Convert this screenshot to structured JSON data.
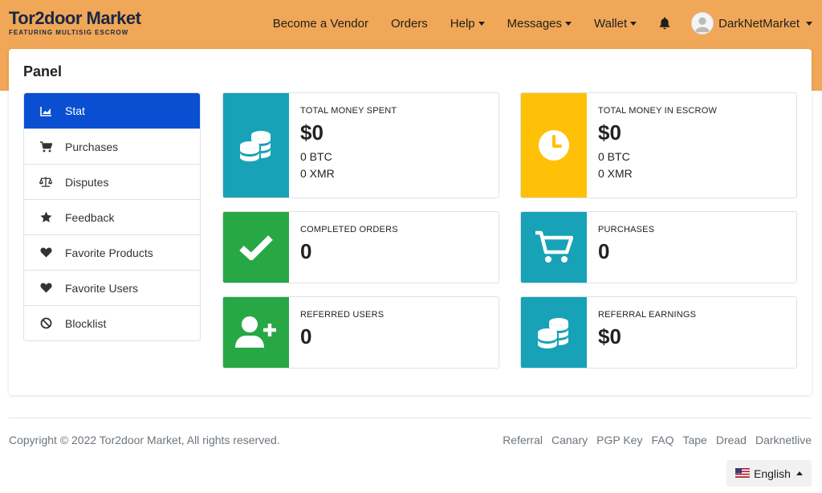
{
  "brand": {
    "name_part1": "Tor",
    "name_part2": "2door Market",
    "tagline": "FEATURING MULTISIG ESCROW"
  },
  "nav": {
    "become_vendor": "Become a Vendor",
    "orders": "Orders",
    "help": "Help",
    "messages": "Messages",
    "wallet": "Wallet",
    "username": "DarkNetMarket"
  },
  "panel": {
    "title": "Panel"
  },
  "sidebar": {
    "items": [
      {
        "label": "Stat",
        "icon": "chart-area-icon"
      },
      {
        "label": "Purchases",
        "icon": "cart-icon"
      },
      {
        "label": "Disputes",
        "icon": "balance-scale-icon"
      },
      {
        "label": "Feedback",
        "icon": "star-icon"
      },
      {
        "label": "Favorite Products",
        "icon": "heart-icon"
      },
      {
        "label": "Favorite Users",
        "icon": "heart-icon"
      },
      {
        "label": "Blocklist",
        "icon": "ban-icon"
      }
    ]
  },
  "stats": {
    "total_spent": {
      "label": "TOTAL MONEY SPENT",
      "value": "$0",
      "btc": "0 BTC",
      "xmr": "0 XMR"
    },
    "total_escrow": {
      "label": "TOTAL MONEY IN ESCROW",
      "value": "$0",
      "btc": "0 BTC",
      "xmr": "0 XMR"
    },
    "completed_orders": {
      "label": "COMPLETED ORDERS",
      "value": "0"
    },
    "purchases": {
      "label": "PURCHASES",
      "value": "0"
    },
    "referred_users": {
      "label": "REFERRED USERS",
      "value": "0"
    },
    "referral_earnings": {
      "label": "REFERRAL EARNINGS",
      "value": "$0"
    }
  },
  "colors": {
    "teal": "#17a2b8",
    "yellow": "#ffc107",
    "green": "#28a745",
    "primary": "#0a4fd1",
    "topbar": "#f0a757"
  },
  "footer": {
    "copyright": "Copyright © 2022 Tor2door Market, All rights reserved.",
    "links": [
      "Referral",
      "Canary",
      "PGP Key",
      "FAQ",
      "Tape",
      "Dread",
      "Darknetlive"
    ],
    "language": "English"
  }
}
